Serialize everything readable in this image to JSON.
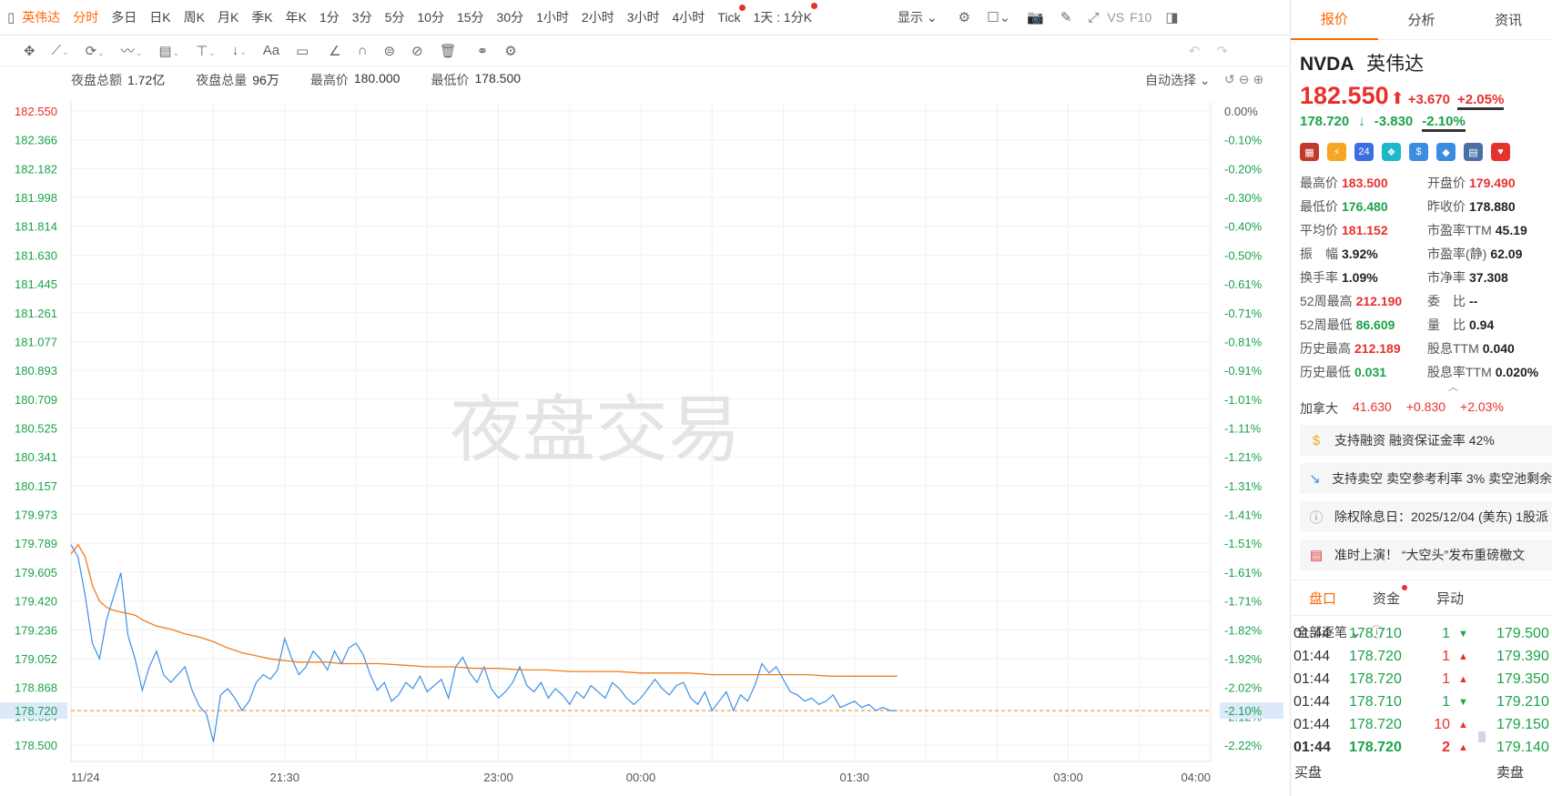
{
  "toolbar": {
    "items": [
      {
        "label": "英伟达",
        "active": true
      },
      {
        "label": "分时",
        "active": true
      },
      {
        "label": "多日"
      },
      {
        "label": "日K"
      },
      {
        "label": "周K"
      },
      {
        "label": "月K"
      },
      {
        "label": "季K"
      },
      {
        "label": "年K"
      },
      {
        "label": "1分"
      },
      {
        "label": "3分"
      },
      {
        "label": "5分"
      },
      {
        "label": "10分"
      },
      {
        "label": "15分"
      },
      {
        "label": "30分"
      },
      {
        "label": "1小时"
      },
      {
        "label": "2小时"
      },
      {
        "label": "3小时"
      },
      {
        "label": "4小时"
      },
      {
        "label": "Tick",
        "dot": true
      },
      {
        "label": "1天 : 1分K",
        "dot": true
      }
    ],
    "display_label": "显示",
    "vs_label": "VS",
    "f10_label": "F10"
  },
  "info": {
    "amount_label": "夜盘总额",
    "amount_value": "1.72亿",
    "volume_label": "夜盘总量",
    "volume_value": "96万",
    "high_label": "最高价",
    "high_value": "180.000",
    "low_label": "最低价",
    "low_value": "178.500",
    "auto_select": "自动选择"
  },
  "chart_data": {
    "type": "line",
    "watermark": "夜盘交易",
    "y_ticks": [
      "182.550",
      "182.366",
      "182.182",
      "181.998",
      "181.814",
      "181.630",
      "181.445",
      "181.261",
      "181.077",
      "180.893",
      "180.709",
      "180.525",
      "180.341",
      "180.157",
      "179.973",
      "179.789",
      "179.605",
      "179.420",
      "179.236",
      "179.052",
      "178.868",
      "178.684",
      "178.500"
    ],
    "y_pct_ticks": [
      "0.00%",
      "-0.10%",
      "-0.20%",
      "-0.30%",
      "-0.40%",
      "-0.50%",
      "-0.61%",
      "-0.71%",
      "-0.81%",
      "-0.91%",
      "-1.01%",
      "-1.11%",
      "-1.21%",
      "-1.31%",
      "-1.41%",
      "-1.51%",
      "-1.61%",
      "-1.71%",
      "-1.82%",
      "-1.92%",
      "-2.02%",
      "-2.12%",
      "-2.22%"
    ],
    "ylim": [
      178.5,
      182.55
    ],
    "x_ticks": [
      "11/24",
      "21:30",
      "23:00",
      "00:00",
      "01:30",
      "03:00",
      "04:00"
    ],
    "x_tick_minutes": [
      0,
      90,
      180,
      240,
      330,
      420,
      480
    ],
    "current_price": 178.72,
    "current_price_label": "178.720",
    "current_pct_label": "-2.10%",
    "series": [
      {
        "role": "price",
        "color": "#3d8fe6",
        "x": [
          0,
          3,
          6,
          9,
          12,
          15,
          18,
          21,
          24,
          27,
          30,
          33,
          36,
          39,
          42,
          45,
          48,
          51,
          54,
          57,
          60,
          63,
          66,
          69,
          72,
          75,
          78,
          81,
          84,
          87,
          90,
          93,
          96,
          99,
          102,
          105,
          108,
          111,
          114,
          117,
          120,
          123,
          126,
          129,
          132,
          135,
          138,
          141,
          144,
          147,
          150,
          153,
          156,
          159,
          162,
          165,
          168,
          171,
          174,
          177,
          180,
          183,
          186,
          189,
          192,
          195,
          198,
          201,
          204,
          207,
          210,
          213,
          216,
          219,
          222,
          225,
          228,
          231,
          234,
          237,
          240,
          243,
          246,
          249,
          252,
          255,
          258,
          261,
          264,
          267,
          270,
          273,
          276,
          279,
          282,
          285,
          288,
          291,
          294,
          297,
          300,
          303,
          306,
          309,
          312,
          315,
          318,
          321,
          324,
          327,
          330,
          333,
          336,
          339,
          342,
          345,
          348
        ],
        "y": [
          179.78,
          179.7,
          179.45,
          179.15,
          179.05,
          179.3,
          179.45,
          179.6,
          179.2,
          179.05,
          178.85,
          179.0,
          179.1,
          178.95,
          178.9,
          178.95,
          179.0,
          178.85,
          178.75,
          178.7,
          178.52,
          178.82,
          178.86,
          178.8,
          178.72,
          178.78,
          178.9,
          178.95,
          178.92,
          178.98,
          179.18,
          179.05,
          178.95,
          179.0,
          179.1,
          179.05,
          178.98,
          179.1,
          179.02,
          179.12,
          179.15,
          179.08,
          178.95,
          178.85,
          178.9,
          178.78,
          178.82,
          178.9,
          178.86,
          178.94,
          178.84,
          178.88,
          178.92,
          178.8,
          179.0,
          179.06,
          178.96,
          178.9,
          179.0,
          178.86,
          178.8,
          178.84,
          178.9,
          179.0,
          178.88,
          178.84,
          178.9,
          178.8,
          178.86,
          178.82,
          178.76,
          178.84,
          178.8,
          178.88,
          178.84,
          178.8,
          178.9,
          178.86,
          178.8,
          178.76,
          178.8,
          178.86,
          178.92,
          178.86,
          178.82,
          178.88,
          178.9,
          178.8,
          178.76,
          178.84,
          178.72,
          178.78,
          178.84,
          178.72,
          178.82,
          178.78,
          178.88,
          179.02,
          178.96,
          179.0,
          178.92,
          178.84,
          178.82,
          178.78,
          178.8,
          178.76,
          178.78,
          178.82,
          178.74,
          178.76,
          178.78,
          178.74,
          178.76,
          178.72,
          178.74,
          178.72,
          178.72
        ]
      },
      {
        "role": "average",
        "color": "#f07d1a",
        "x": [
          0,
          3,
          6,
          9,
          12,
          15,
          18,
          21,
          24,
          27,
          30,
          36,
          42,
          48,
          54,
          60,
          66,
          72,
          78,
          84,
          90,
          96,
          102,
          108,
          114,
          120,
          130,
          140,
          150,
          160,
          170,
          180,
          190,
          200,
          210,
          220,
          230,
          240,
          250,
          260,
          270,
          280,
          290,
          300,
          310,
          320,
          330,
          340,
          348
        ],
        "y": [
          179.72,
          179.78,
          179.7,
          179.52,
          179.42,
          179.38,
          179.36,
          179.35,
          179.34,
          179.33,
          179.3,
          179.26,
          179.24,
          179.21,
          179.19,
          179.16,
          179.12,
          179.09,
          179.07,
          179.05,
          179.04,
          179.03,
          179.03,
          179.03,
          179.02,
          179.02,
          179.02,
          179.01,
          179.0,
          179.0,
          178.99,
          178.99,
          178.98,
          178.98,
          178.97,
          178.97,
          178.97,
          178.96,
          178.96,
          178.96,
          178.95,
          178.95,
          178.95,
          178.95,
          178.95,
          178.94,
          178.94,
          178.94,
          178.94
        ]
      }
    ]
  },
  "right": {
    "tabs": [
      "报价",
      "分析",
      "资讯"
    ],
    "symbol": "NVDA",
    "name": "英伟达",
    "price": "182.550",
    "change": "+3.670",
    "change_pct": "+2.05%",
    "ah_price": "178.720",
    "ah_change": "-3.830",
    "ah_change_pct": "-2.10%",
    "badges": [
      {
        "icon": "us-flag-icon",
        "color": "#c0392b",
        "text": "▦"
      },
      {
        "icon": "lightning-icon",
        "color": "#f5a623",
        "text": "⚡"
      },
      {
        "icon": "24h-icon",
        "color": "#3b6fe0",
        "text": "24"
      },
      {
        "icon": "leaf-icon",
        "color": "#1cb8c8",
        "text": "❖"
      },
      {
        "icon": "dollar-icon",
        "color": "#3b8de0",
        "text": "$"
      },
      {
        "icon": "tag-icon",
        "color": "#3b8de0",
        "text": "◆"
      },
      {
        "icon": "doc-icon",
        "color": "#4a6fa5",
        "text": "▤"
      },
      {
        "icon": "heart-icon",
        "color": "#e8302c",
        "text": "♥"
      }
    ],
    "stats": [
      {
        "k": "最高价",
        "v": "183.500",
        "c": "red"
      },
      {
        "k": "开盘价",
        "v": "179.490",
        "c": "red"
      },
      {
        "k": "最低价",
        "v": "176.480",
        "c": "green"
      },
      {
        "k": "昨收价",
        "v": "178.880",
        "c": ""
      },
      {
        "k": "平均价",
        "v": "181.152",
        "c": "red"
      },
      {
        "k": "市盈率TTM",
        "v": "45.19",
        "c": ""
      },
      {
        "k": "振　幅",
        "v": "3.92%",
        "c": ""
      },
      {
        "k": "市盈率(静)",
        "v": "62.09",
        "c": ""
      },
      {
        "k": "换手率",
        "v": "1.09%",
        "c": ""
      },
      {
        "k": "市净率",
        "v": "37.308",
        "c": ""
      },
      {
        "k": "52周最高",
        "v": "212.190",
        "c": "red"
      },
      {
        "k": "委　比",
        "v": "--",
        "c": ""
      },
      {
        "k": "52周最低",
        "v": "86.609",
        "c": "green"
      },
      {
        "k": "量　比",
        "v": "0.94",
        "c": ""
      },
      {
        "k": "历史最高",
        "v": "212.189",
        "c": "red"
      },
      {
        "k": "股息TTM",
        "v": "0.040",
        "c": ""
      },
      {
        "k": "历史最低",
        "v": "0.031",
        "c": "green"
      },
      {
        "k": "股息率TTM",
        "v": "0.020%",
        "c": ""
      }
    ],
    "canada": {
      "label": "加拿大",
      "price": "41.630",
      "change": "+0.830",
      "pct": "+2.03%"
    },
    "notices": [
      {
        "icon": "margin-icon",
        "glyph": "$",
        "color": "#f5a623",
        "text": "支持融资  融资保证金率 42%"
      },
      {
        "icon": "short-icon",
        "glyph": "↘",
        "color": "#3b8de0",
        "text": "支持卖空  卖空参考利率 3%  卖空池剩余"
      },
      {
        "icon": "info-icon",
        "glyph": "ⓘ",
        "color": "#999999",
        "text": "除权除息日：2025/12/04 (美东)  1股派"
      },
      {
        "icon": "news-icon",
        "glyph": "▤",
        "color": "#e8302c",
        "text": "准时上演！ “大空头”发布重磅檄文"
      }
    ],
    "bottom_tabs": [
      "盘口",
      "资金",
      "异动"
    ],
    "filter_label": "全部逐笔",
    "trades": [
      {
        "time": "01:44",
        "price": "178.710",
        "vol": "1",
        "dir": "down",
        "right_price": "179.500"
      },
      {
        "time": "01:44",
        "price": "178.720",
        "vol": "1",
        "dir": "up",
        "right_price": "179.390"
      },
      {
        "time": "01:44",
        "price": "178.720",
        "vol": "1",
        "dir": "up",
        "right_price": "179.350"
      },
      {
        "time": "01:44",
        "price": "178.710",
        "vol": "1",
        "dir": "down",
        "right_price": "179.210"
      },
      {
        "time": "01:44",
        "price": "178.720",
        "vol": "10",
        "dir": "up",
        "right_price": "179.150"
      },
      {
        "time": "01:44",
        "price": "178.720",
        "vol": "2",
        "dir": "up",
        "right_price": "179.140"
      }
    ],
    "buy_label": "买盘",
    "sell_label": "卖盘"
  }
}
